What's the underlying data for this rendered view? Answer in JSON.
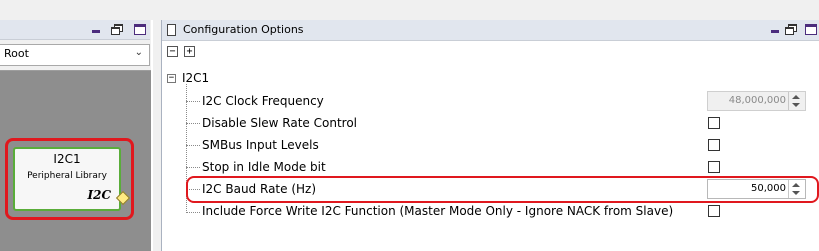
{
  "left_panel": {
    "root_select": {
      "value": "Root"
    },
    "node": {
      "title": "I2C1",
      "subtitle": "Peripheral Library",
      "badge": "I2C"
    }
  },
  "config_panel": {
    "title": "Configuration Options",
    "collapse_label": "−",
    "expand_label": "+",
    "tree_root": {
      "toggle": "−",
      "label": "I2C1"
    },
    "rows": [
      {
        "label": "I2C Clock Frequency",
        "value": "48,000,000"
      },
      {
        "label": "Disable Slew Rate Control"
      },
      {
        "label": "SMBus Input Levels"
      },
      {
        "label": "Stop in Idle Mode bit"
      },
      {
        "label": "I2C Baud Rate (Hz)",
        "value": "50,000"
      },
      {
        "label": "Include Force Write I2C Function (Master Mode Only - Ignore NACK from Slave)"
      }
    ]
  },
  "colors": {
    "highlight": "#e0181e",
    "node_border": "#5aad3a",
    "canvas": "#8e8e8e",
    "titlebar": "#e1e6ee"
  }
}
